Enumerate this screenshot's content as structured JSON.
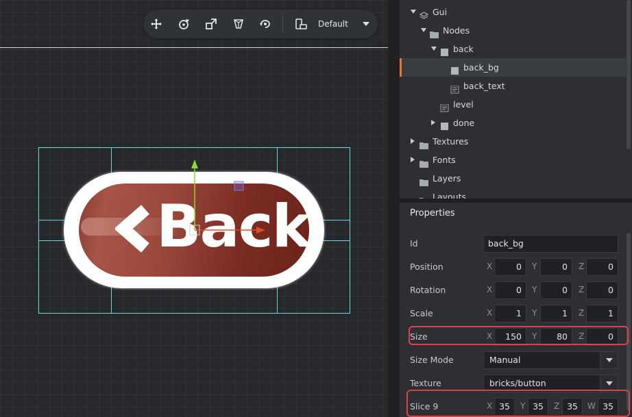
{
  "toolbar": {
    "tools": [
      "move-tool-icon",
      "rotate-tool-icon",
      "scale-tool-icon",
      "perspective-toggle-icon",
      "camera-reset-icon"
    ],
    "layout_label": "Default"
  },
  "canvas": {
    "button_text": "Back"
  },
  "outline": {
    "items": [
      {
        "label": "Gui",
        "icon": "gui-scene-icon",
        "expand": "down"
      },
      {
        "label": "Nodes",
        "icon": "folder-icon",
        "expand": "down"
      },
      {
        "label": "back",
        "icon": "box-node-icon",
        "expand": "down"
      },
      {
        "label": "back_bg",
        "icon": "box-node-icon",
        "expand": "none",
        "selected": true
      },
      {
        "label": "back_text",
        "icon": "text-node-icon",
        "expand": "none"
      },
      {
        "label": "level",
        "icon": "text-node-icon",
        "expand": "none"
      },
      {
        "label": "done",
        "icon": "box-node-icon",
        "expand": "right"
      },
      {
        "label": "Textures",
        "icon": "folder-icon",
        "expand": "right"
      },
      {
        "label": "Fonts",
        "icon": "folder-icon",
        "expand": "right"
      },
      {
        "label": "Layers",
        "icon": "folder-icon",
        "expand": "none"
      },
      {
        "label": "Layouts",
        "icon": "folder-icon",
        "expand": "none"
      }
    ]
  },
  "properties": {
    "title": "Properties",
    "id": {
      "label": "Id",
      "value": "back_bg"
    },
    "position": {
      "label": "Position",
      "x": "0",
      "y": "0",
      "z": "0"
    },
    "rotation": {
      "label": "Rotation",
      "x": "0",
      "y": "0",
      "z": "0"
    },
    "scale": {
      "label": "Scale",
      "x": "1",
      "y": "1",
      "z": "1"
    },
    "size": {
      "label": "Size",
      "x": "150",
      "y": "80",
      "z": "0"
    },
    "size_mode": {
      "label": "Size Mode",
      "value": "Manual"
    },
    "texture": {
      "label": "Texture",
      "value": "bricks/button"
    },
    "slice9": {
      "label": "Slice 9",
      "x": "35",
      "y": "35",
      "z": "35",
      "w": "35"
    },
    "axis": {
      "x": "X",
      "y": "Y",
      "z": "Z",
      "w": "W"
    }
  },
  "colors": {
    "highlight": "#d9434a",
    "selection": "#6fd8d8",
    "accent": "#e27a2f"
  }
}
